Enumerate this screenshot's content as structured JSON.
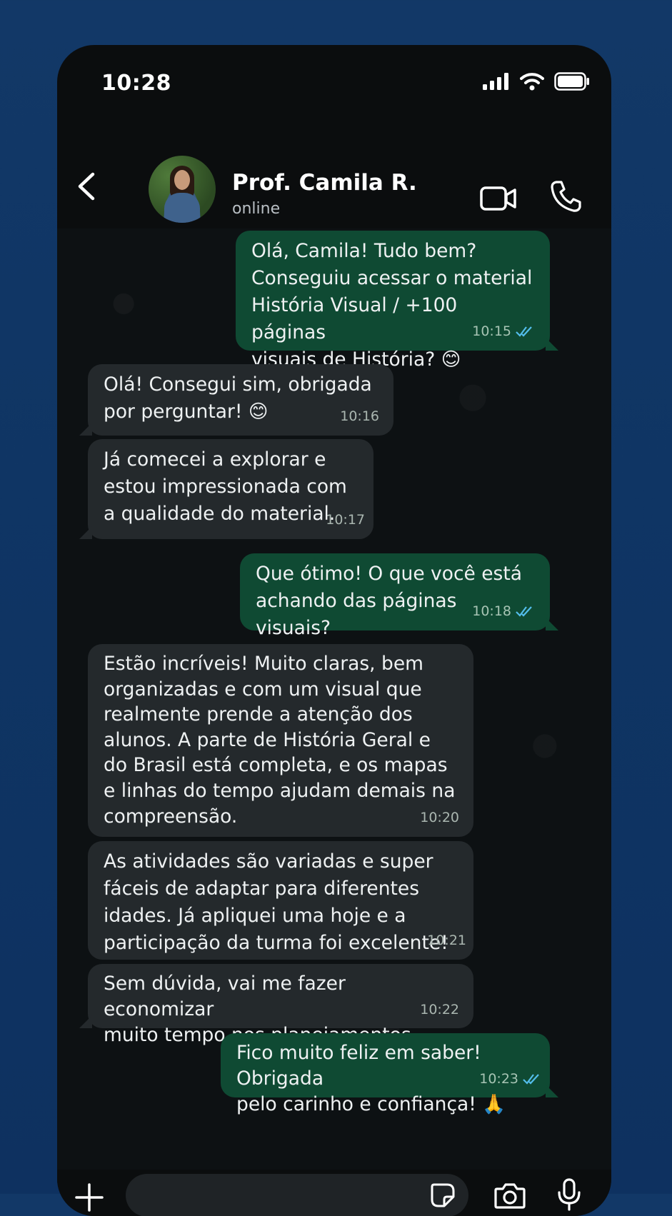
{
  "status_bar": {
    "time": "10:28"
  },
  "contact": {
    "name": "Prof. Camila R.",
    "presence": "online"
  },
  "messages": [
    {
      "dir": "out",
      "text": "Olá, Camila! Tudo bem?\nConseguiu acessar o material\nHistória Visual / +100 páginas\nvisuais de História? 😊",
      "time": "10:15",
      "read": true
    },
    {
      "dir": "in",
      "text": "Olá! Consegui sim, obrigada\npor perguntar! 😊",
      "time": "10:16"
    },
    {
      "dir": "in",
      "text": "Já comecei a explorar e\nestou impressionada com\na qualidade do material.",
      "time": "10:17"
    },
    {
      "dir": "out",
      "text": "Que ótimo! O que você está\nachando das páginas visuais?",
      "time": "10:18",
      "read": true
    },
    {
      "dir": "in",
      "text": "Estão incríveis! Muito claras, bem\norganizadas e com um visual que\nrealmente prende a atenção dos\nalunos. A parte de História Geral e\ndo Brasil está completa, e os mapas\ne linhas do tempo ajudam demais na\ncompreensão.",
      "time": "10:20"
    },
    {
      "dir": "in",
      "text": "As atividades são variadas e super\nfáceis de adaptar para diferentes\nidades. Já apliquei uma hoje e a\nparticipação da turma foi excelente!",
      "time": "10:21"
    },
    {
      "dir": "in",
      "text": "Sem dúvida, vai me fazer economizar\nmuito tempo nos planejamentos.",
      "time": "10:22"
    },
    {
      "dir": "out",
      "text": "Fico muito feliz em saber! Obrigada\npelo carinho e confiança! 🙏",
      "time": "10:23",
      "read": true
    }
  ],
  "input": {
    "placeholder": ""
  },
  "colors": {
    "outgoing_bubble": "#0f4a33",
    "incoming_bubble": "#24292c",
    "read_ticks": "#53bdeb",
    "background": "#123867"
  },
  "icons": [
    "back-icon",
    "video-call-icon",
    "voice-call-icon",
    "plus-icon",
    "sticker-icon",
    "camera-icon",
    "microphone-icon",
    "signal-icon",
    "wifi-icon",
    "battery-icon"
  ]
}
